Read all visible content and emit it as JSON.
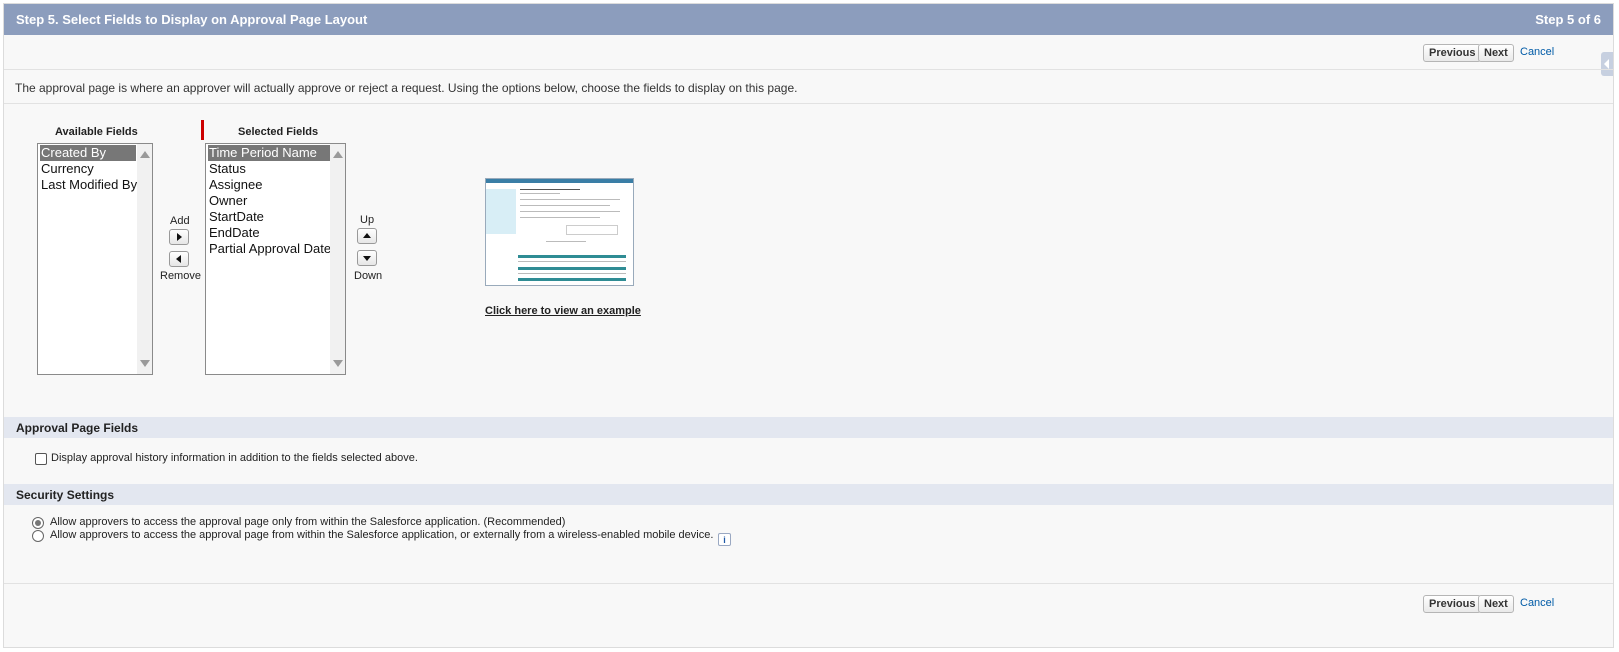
{
  "header": {
    "title": "Step 5. Select Fields to Display on Approval Page Layout",
    "step": "Step 5 of 6"
  },
  "nav": {
    "previous": "Previous",
    "next": "Next",
    "cancel": "Cancel"
  },
  "description": "The approval page is where an approver will actually approve or reject a request. Using the options below, choose the fields to display on this page.",
  "available": {
    "label": "Available Fields",
    "items": [
      "Created By",
      "Currency",
      "Last Modified By"
    ],
    "selected_index": 0
  },
  "selected": {
    "label": "Selected Fields",
    "items": [
      "Time Period Name",
      "Status",
      "Assignee",
      "Owner",
      "StartDate",
      "EndDate",
      "Partial Approval Date"
    ],
    "selected_index": 0
  },
  "controls": {
    "add": "Add",
    "remove": "Remove",
    "up": "Up",
    "down": "Down"
  },
  "example_link": "Click here to view an example",
  "approval_page_fields": {
    "title": "Approval Page Fields",
    "checkbox_label": "Display approval history information in addition to the fields selected above.",
    "checked": false
  },
  "security": {
    "title": "Security Settings",
    "options": [
      "Allow approvers to access the approval page only from within the Salesforce application. (Recommended)",
      "Allow approvers to access the approval page from within the Salesforce application, or externally from a wireless-enabled mobile device."
    ],
    "selected_index": 0
  },
  "colors": {
    "header_bg": "#8c9dbd",
    "section_bg": "#e3e7f0",
    "link": "#015ba7",
    "required_bar": "#cc0000"
  }
}
